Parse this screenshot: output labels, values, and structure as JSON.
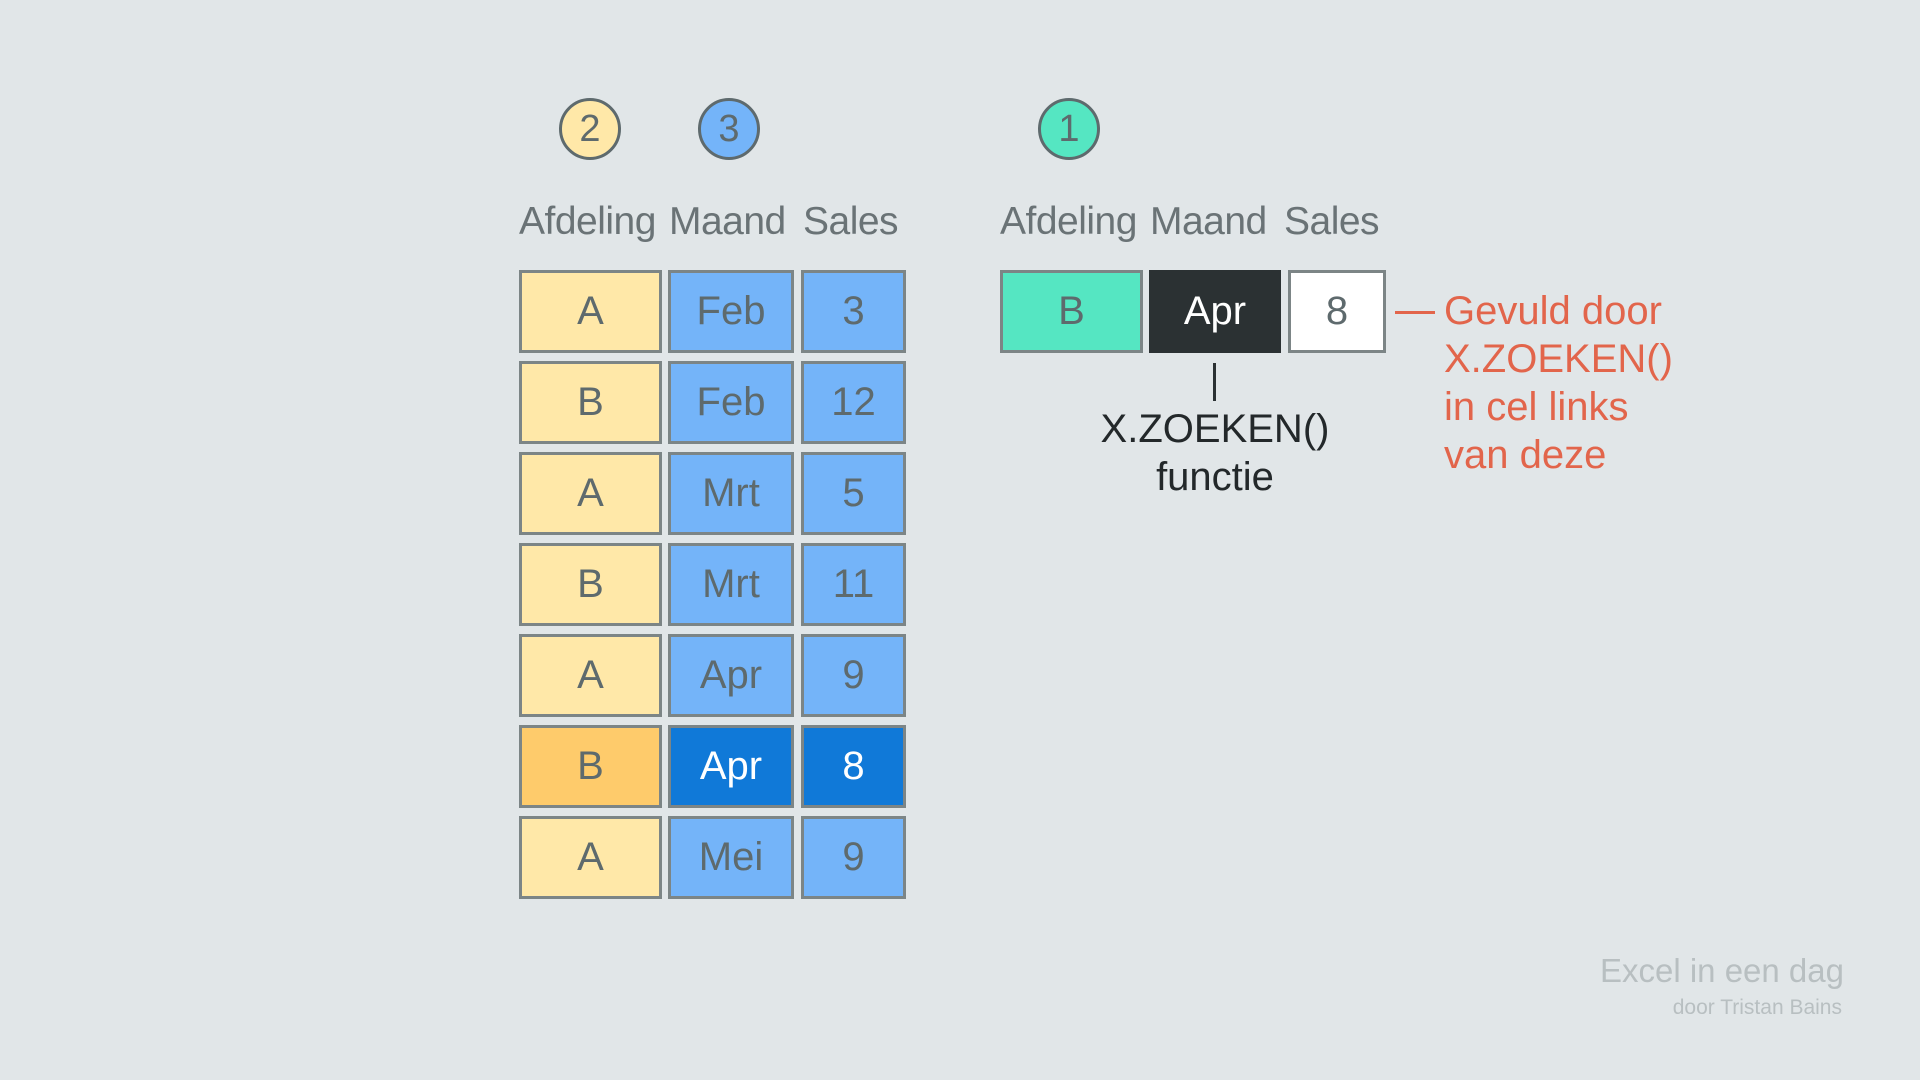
{
  "badges": {
    "dept": "2",
    "month": "3",
    "lookup": "1"
  },
  "colors": {
    "background": "#e1e6e8",
    "dept_fill": "#ffe8a8",
    "dept_highlight": "#fecb6b",
    "month_sales_fill": "#74b4f9",
    "month_sales_highlight": "#1079d8",
    "lookup_key_fill": "#55e6c2",
    "lookup_month_fill": "#2b3133",
    "result_fill": "#ffffff",
    "annotation_red": "#e2654b"
  },
  "source_table": {
    "headers": {
      "dept": "Afdeling",
      "month": "Maand",
      "sales": "Sales"
    },
    "rows": [
      {
        "dept": "A",
        "month": "Feb",
        "sales": "3",
        "highlighted": false
      },
      {
        "dept": "B",
        "month": "Feb",
        "sales": "12",
        "highlighted": false
      },
      {
        "dept": "A",
        "month": "Mrt",
        "sales": "5",
        "highlighted": false
      },
      {
        "dept": "B",
        "month": "Mrt",
        "sales": "11",
        "highlighted": false
      },
      {
        "dept": "A",
        "month": "Apr",
        "sales": "9",
        "highlighted": false
      },
      {
        "dept": "B",
        "month": "Apr",
        "sales": "8",
        "highlighted": true
      },
      {
        "dept": "A",
        "month": "Mei",
        "sales": "9",
        "highlighted": false
      }
    ]
  },
  "lookup_table": {
    "headers": {
      "dept": "Afdeling",
      "month": "Maand",
      "sales": "Sales"
    },
    "row": {
      "dept": "B",
      "month": "Apr",
      "sales": "8"
    }
  },
  "annotations": {
    "function_line1": "X.ZOEKEN()",
    "function_line2": "functie",
    "filled_by_line1": "Gevuld door",
    "filled_by_line2": "X.ZOEKEN()",
    "filled_by_line3": "in cel links",
    "filled_by_line4": "van deze"
  },
  "footer": {
    "title": "Excel in een dag",
    "subtitle": "door Tristan Bains"
  }
}
